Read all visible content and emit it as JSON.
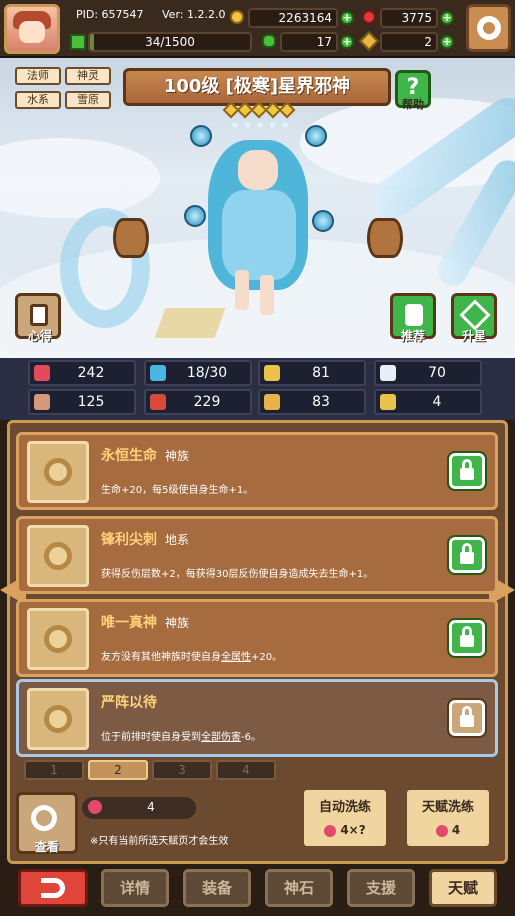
{
  "header": {
    "pid_label": "PID: 657547",
    "version": "Ver: 1.2.2.0",
    "gold": "2263164",
    "gems": "3775",
    "stamina": "34/1500",
    "stamina_fill": 0.023,
    "clovers": "17",
    "keys": "2",
    "icons": {
      "gold": "coin-icon",
      "gems": "gem-icon",
      "stamina": "plus-cross-icon",
      "clovers": "clover-icon",
      "keys": "key-icon",
      "settings": "gear-icon"
    }
  },
  "hero": {
    "title": "100级 [极寒]星界邪神",
    "stars": 5,
    "tags": [
      "法师",
      "神灵",
      "水系",
      "雪原"
    ],
    "help_label": "帮助",
    "left_button": "心得",
    "recommend_button": "推荐",
    "upgrade_button": "升星"
  },
  "stats": [
    {
      "icon": "heart-icon",
      "value": "242",
      "color": "#e24a5c"
    },
    {
      "icon": "water-drop-icon",
      "value": "18/30",
      "color": "#4ab6e6"
    },
    {
      "icon": "shield-icon",
      "value": "81",
      "color": "#e8c24a"
    },
    {
      "icon": "wing-icon",
      "value": "70",
      "color": "#e6eef6"
    },
    {
      "icon": "fist-icon",
      "value": "125",
      "color": "#d59a7a"
    },
    {
      "icon": "book-icon",
      "value": "229",
      "color": "#d84a3a"
    },
    {
      "icon": "scroll-icon",
      "value": "83",
      "color": "#e8b34a"
    },
    {
      "icon": "horseshoe-icon",
      "value": "4",
      "color": "#e8c24a"
    }
  ],
  "talents": [
    {
      "name": "永恒生命",
      "kind": "神族",
      "desc_parts": [
        "生命+20，每5级使自身生命+1。"
      ],
      "locked": true
    },
    {
      "name": "锋利尖刺",
      "kind": "地系",
      "desc_parts": [
        "获得反伤层数+2，每获得30层反伤使自身造成失去生命+1。"
      ],
      "locked": true
    },
    {
      "name": "唯一真神",
      "kind": "神族",
      "desc_parts": [
        "友方没有其他神族时使自身",
        "全属性",
        "+20。"
      ],
      "locked": true
    },
    {
      "name": "严阵以待",
      "kind": "",
      "desc_parts": [
        "位于前排时使自身受到",
        "全部伤害",
        "-6。"
      ],
      "locked": false
    }
  ],
  "pages": [
    "1",
    "2",
    "3",
    "4"
  ],
  "active_page": "2",
  "bottom": {
    "view_label": "查看",
    "count": "4",
    "note": "※只有当前所选天赋页才会生效",
    "auto_reroll": {
      "label": "自动洗练",
      "cost": "4×?"
    },
    "talent_reroll": {
      "label": "天赋洗练",
      "cost": "4"
    }
  },
  "nav": {
    "items": [
      "详情",
      "装备",
      "神石",
      "支援",
      "天赋"
    ],
    "active": "天赋"
  }
}
